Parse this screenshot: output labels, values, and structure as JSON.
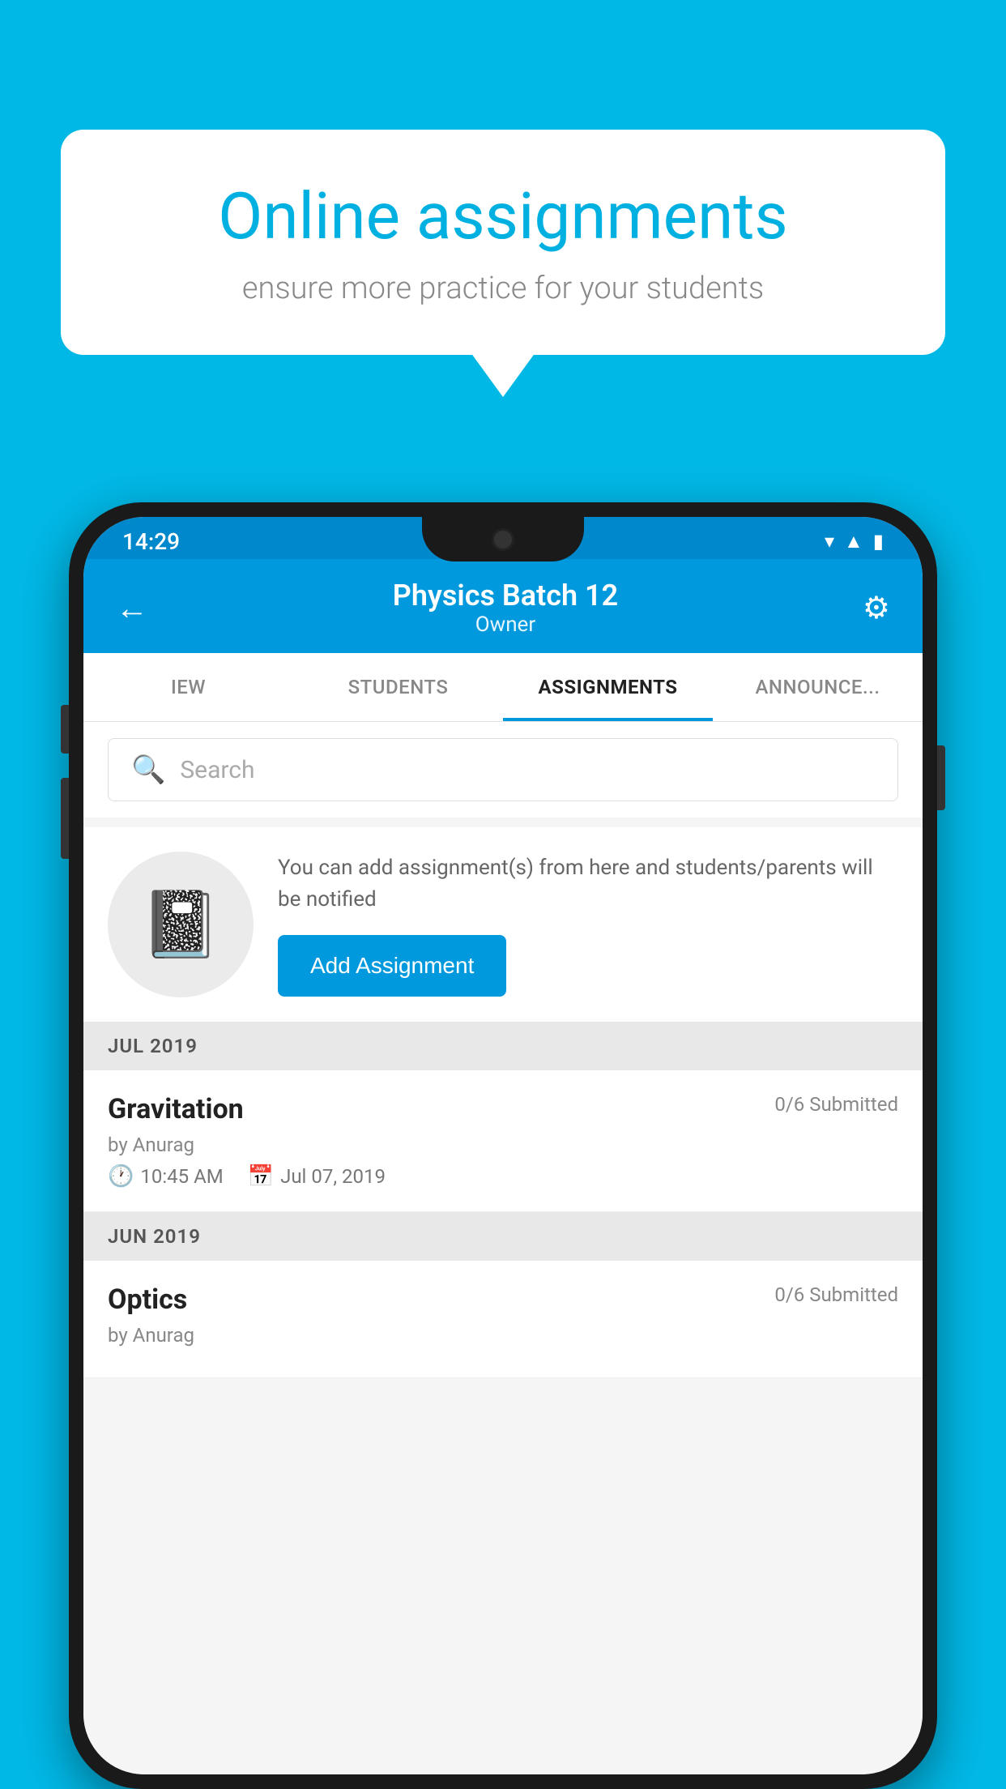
{
  "background_color": "#00b8e6",
  "speech_bubble": {
    "title": "Online assignments",
    "subtitle": "ensure more practice for your students"
  },
  "phone": {
    "status_bar": {
      "time": "14:29",
      "icons": [
        "wifi",
        "signal",
        "battery"
      ]
    },
    "header": {
      "title": "Physics Batch 12",
      "subtitle": "Owner",
      "back_label": "←",
      "settings_label": "⚙"
    },
    "tabs": [
      {
        "label": "IEW",
        "active": false
      },
      {
        "label": "STUDENTS",
        "active": false
      },
      {
        "label": "ASSIGNMENTS",
        "active": true
      },
      {
        "label": "ANNOUNCEMENTS",
        "active": false
      }
    ],
    "search": {
      "placeholder": "Search"
    },
    "promo": {
      "text": "You can add assignment(s) from here and students/parents will be notified",
      "button_label": "Add Assignment"
    },
    "sections": [
      {
        "month_label": "JUL 2019",
        "assignments": [
          {
            "name": "Gravitation",
            "submitted": "0/6 Submitted",
            "by": "by Anurag",
            "time": "10:45 AM",
            "date": "Jul 07, 2019"
          }
        ]
      },
      {
        "month_label": "JUN 2019",
        "assignments": [
          {
            "name": "Optics",
            "submitted": "0/6 Submitted",
            "by": "by Anurag",
            "time": "",
            "date": ""
          }
        ]
      }
    ]
  }
}
